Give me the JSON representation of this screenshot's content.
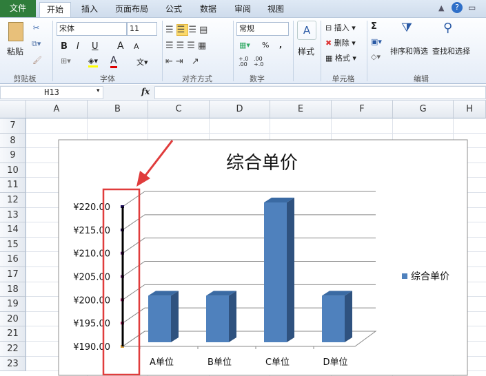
{
  "tabs": [
    "文件",
    "开始",
    "插入",
    "页面布局",
    "公式",
    "数据",
    "审阅",
    "视图"
  ],
  "ribbon": {
    "clipboard": {
      "paste": "粘贴",
      "label": "剪贴板"
    },
    "font": {
      "name": "宋体",
      "size": "11",
      "bold": "B",
      "italic": "I",
      "underline": "U",
      "grow": "A",
      "shrink": "A",
      "label": "字体"
    },
    "alignment": {
      "label": "对齐方式"
    },
    "number": {
      "format": "常规",
      "percent": "%",
      "comma": ",",
      "inc": "+.0 .00",
      "dec": ".00 +.0",
      "label": "数字"
    },
    "styles": {
      "label": "样式"
    },
    "cells": {
      "insert": "插入",
      "delete": "删除",
      "format": "格式",
      "label": "单元格"
    },
    "editing": {
      "sum": "Σ",
      "sort": "排序和筛选",
      "find": "查找和选择",
      "label": "编辑"
    }
  },
  "formula_bar": {
    "name_box": "H13",
    "fx": "fx",
    "value": ""
  },
  "columns": [
    "A",
    "B",
    "C",
    "D",
    "E",
    "F",
    "G",
    "H"
  ],
  "rows": [
    "7",
    "8",
    "9",
    "10",
    "11",
    "12",
    "13",
    "14",
    "15",
    "16",
    "17",
    "18",
    "19",
    "20",
    "21",
    "22",
    "23"
  ],
  "chart_data": {
    "type": "bar",
    "title": "综合单价",
    "categories": [
      "A单位",
      "B单位",
      "C单位",
      "D单位"
    ],
    "series": [
      {
        "name": "综合单价",
        "values": [
          200,
          200,
          220,
          200
        ]
      }
    ],
    "yticks": [
      "¥190.00",
      "¥195.00",
      "¥200.00",
      "¥205.00",
      "¥210.00",
      "¥215.00",
      "¥220.00"
    ],
    "ylim": [
      190,
      220
    ],
    "legend": "right",
    "bar_color": "#4f81bd",
    "highlight_color": "#e03c3c"
  }
}
